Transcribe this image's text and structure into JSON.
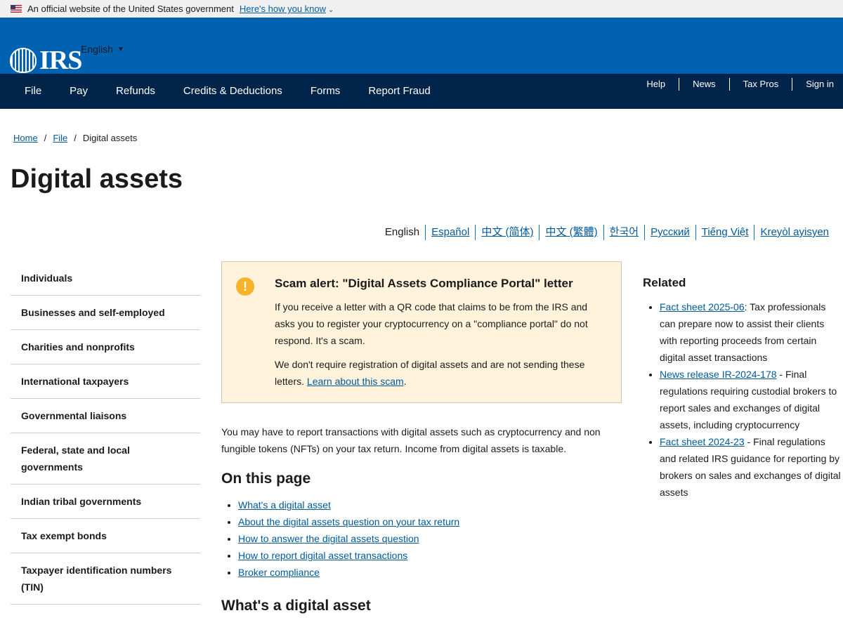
{
  "gov_banner": {
    "text": "An official website of the United States government",
    "link": "Here's how you know"
  },
  "header": {
    "logo_text": "IRS",
    "language": "English"
  },
  "nav": {
    "main": [
      "File",
      "Pay",
      "Refunds",
      "Credits & Deductions",
      "Forms",
      "Report Fraud"
    ],
    "utility": [
      "Help",
      "News",
      "Tax Pros",
      "Sign in"
    ]
  },
  "breadcrumb": {
    "items": [
      "Home",
      "File",
      "Digital assets"
    ],
    "separator": "/"
  },
  "page": {
    "title": "Digital assets"
  },
  "languages": [
    "English",
    "Español",
    "中文 (简体)",
    "中文 (繁體)",
    "한국어",
    "Русский",
    "Tiếng Việt",
    "Kreyòl ayisyen"
  ],
  "sidenav": [
    "Individuals",
    "Businesses and self-employed",
    "Charities and nonprofits",
    "International taxpayers",
    "Governmental liaisons",
    "Federal, state and local governments",
    "Indian tribal governments",
    "Tax exempt bonds",
    "Taxpayer identification numbers (TIN)"
  ],
  "alert": {
    "icon": "!",
    "title": "Scam alert: \"Digital Assets Compliance Portal\" letter",
    "p1": "If you receive a letter with a QR code that claims to be from the IRS and asks you to register your cryptocurrency on a \"compliance portal\" do not respond. It's a scam.",
    "p2_text": "We don't require registration of digital assets and are not sending these letters.",
    "p2_link": "Learn about this scam",
    "p2_end": "."
  },
  "intro": "You may have to report transactions with digital assets such as cryptocurrency and non fungible tokens (NFTs) on your tax return. Income from digital assets is taxable.",
  "on_this_page": {
    "title": "On this page",
    "links": [
      "What's a digital asset",
      "About the digital assets question on your tax return",
      "How to answer the digital assets question",
      "How to report digital asset transactions",
      "Broker compliance"
    ]
  },
  "section_title": "What's a digital asset",
  "related": {
    "title": "Related",
    "items": [
      {
        "link": "Fact sheet 2025-06",
        "text": ": Tax professionals can prepare now to assist their clients with reporting proceeds from certain digital asset transactions"
      },
      {
        "link": "News release IR-2024-178",
        "text": " - Final regulations requiring custodial brokers to report sales and exchanges of digital assets, including cryptocurrency"
      },
      {
        "link": "Fact sheet 2024-23",
        "text": " - Final regulations and related IRS guidance for reporting by brokers on sales and exchanges of digital assets"
      }
    ]
  },
  "colors": {
    "header_blue": "#0062b0",
    "nav_navy": "#00244a",
    "link": "#00599c",
    "alert_bg": "#fff3dc",
    "alert_icon": "#f5b32b"
  }
}
